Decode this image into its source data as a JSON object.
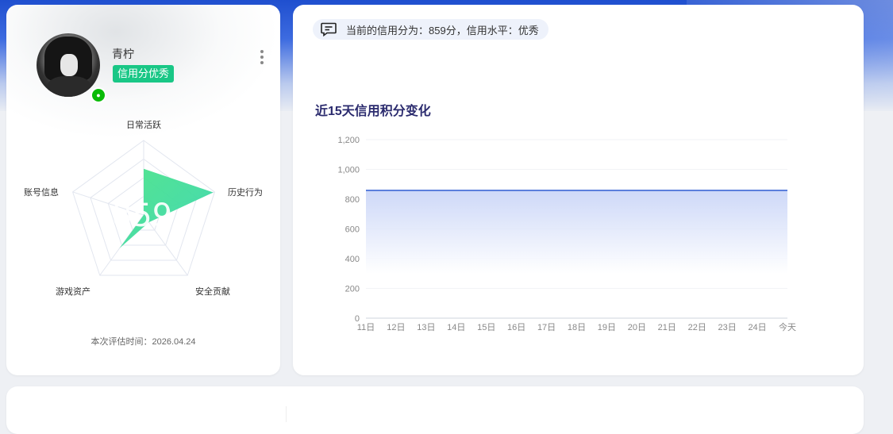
{
  "profile": {
    "username": "青柠",
    "badge": "信用分优秀",
    "avatar_icon": "anime-character-avatar",
    "login_icon": "wechat-icon",
    "score": "859",
    "eval_time": "本次评估时间：2026.04.24",
    "radar": {
      "axes": [
        "日常活跃",
        "历史行为",
        "安全贡献",
        "游戏资产",
        "账号信息"
      ],
      "values": [
        0.62,
        0.98,
        0.12,
        0.55,
        0.0
      ],
      "fill_color": "#3ddc84"
    }
  },
  "credit_info": {
    "message": "当前的信用分为：859分，信用水平：优秀",
    "icon": "message-icon"
  },
  "chart_data": {
    "type": "area",
    "title": "近15天信用积分变化",
    "x": [
      "11日",
      "12日",
      "13日",
      "14日",
      "15日",
      "16日",
      "17日",
      "18日",
      "19日",
      "20日",
      "21日",
      "22日",
      "23日",
      "24日",
      "今天"
    ],
    "series": [
      {
        "values": [
          859,
          859,
          859,
          859,
          859,
          859,
          859,
          859,
          859,
          859,
          859,
          859,
          859,
          859,
          859
        ]
      }
    ],
    "ylim": [
      0,
      1200
    ],
    "yticks": [
      "0",
      "200",
      "400",
      "600",
      "800",
      "1,000",
      "1,200"
    ],
    "grid": true,
    "line_color": "#5b7fdc"
  }
}
